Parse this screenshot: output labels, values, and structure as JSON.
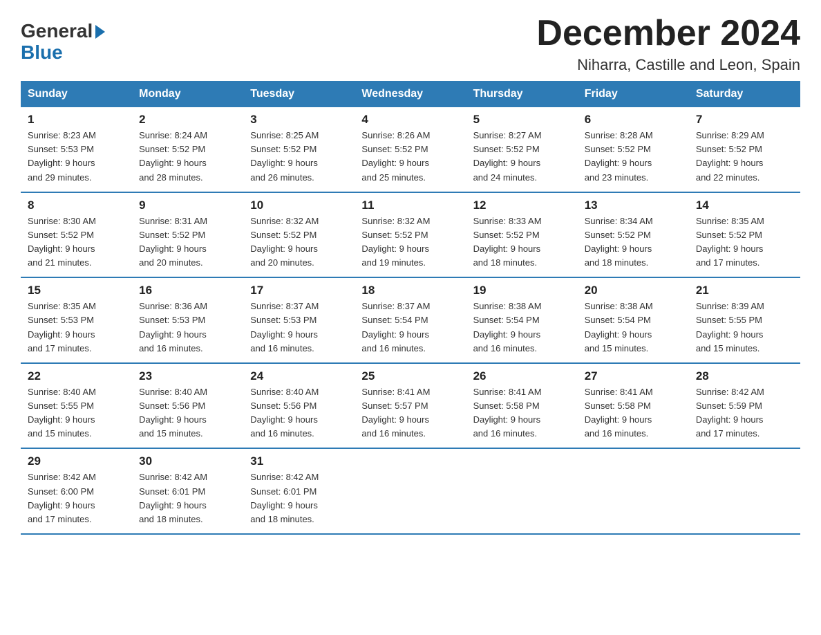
{
  "logo": {
    "general": "General",
    "blue": "Blue",
    "arrow": "▶"
  },
  "title": "December 2024",
  "subtitle": "Niharra, Castille and Leon, Spain",
  "weekdays": [
    "Sunday",
    "Monday",
    "Tuesday",
    "Wednesday",
    "Thursday",
    "Friday",
    "Saturday"
  ],
  "weeks": [
    [
      {
        "day": "1",
        "sunrise": "8:23 AM",
        "sunset": "5:53 PM",
        "daylight": "9 hours and 29 minutes."
      },
      {
        "day": "2",
        "sunrise": "8:24 AM",
        "sunset": "5:52 PM",
        "daylight": "9 hours and 28 minutes."
      },
      {
        "day": "3",
        "sunrise": "8:25 AM",
        "sunset": "5:52 PM",
        "daylight": "9 hours and 26 minutes."
      },
      {
        "day": "4",
        "sunrise": "8:26 AM",
        "sunset": "5:52 PM",
        "daylight": "9 hours and 25 minutes."
      },
      {
        "day": "5",
        "sunrise": "8:27 AM",
        "sunset": "5:52 PM",
        "daylight": "9 hours and 24 minutes."
      },
      {
        "day": "6",
        "sunrise": "8:28 AM",
        "sunset": "5:52 PM",
        "daylight": "9 hours and 23 minutes."
      },
      {
        "day": "7",
        "sunrise": "8:29 AM",
        "sunset": "5:52 PM",
        "daylight": "9 hours and 22 minutes."
      }
    ],
    [
      {
        "day": "8",
        "sunrise": "8:30 AM",
        "sunset": "5:52 PM",
        "daylight": "9 hours and 21 minutes."
      },
      {
        "day": "9",
        "sunrise": "8:31 AM",
        "sunset": "5:52 PM",
        "daylight": "9 hours and 20 minutes."
      },
      {
        "day": "10",
        "sunrise": "8:32 AM",
        "sunset": "5:52 PM",
        "daylight": "9 hours and 20 minutes."
      },
      {
        "day": "11",
        "sunrise": "8:32 AM",
        "sunset": "5:52 PM",
        "daylight": "9 hours and 19 minutes."
      },
      {
        "day": "12",
        "sunrise": "8:33 AM",
        "sunset": "5:52 PM",
        "daylight": "9 hours and 18 minutes."
      },
      {
        "day": "13",
        "sunrise": "8:34 AM",
        "sunset": "5:52 PM",
        "daylight": "9 hours and 18 minutes."
      },
      {
        "day": "14",
        "sunrise": "8:35 AM",
        "sunset": "5:52 PM",
        "daylight": "9 hours and 17 minutes."
      }
    ],
    [
      {
        "day": "15",
        "sunrise": "8:35 AM",
        "sunset": "5:53 PM",
        "daylight": "9 hours and 17 minutes."
      },
      {
        "day": "16",
        "sunrise": "8:36 AM",
        "sunset": "5:53 PM",
        "daylight": "9 hours and 16 minutes."
      },
      {
        "day": "17",
        "sunrise": "8:37 AM",
        "sunset": "5:53 PM",
        "daylight": "9 hours and 16 minutes."
      },
      {
        "day": "18",
        "sunrise": "8:37 AM",
        "sunset": "5:54 PM",
        "daylight": "9 hours and 16 minutes."
      },
      {
        "day": "19",
        "sunrise": "8:38 AM",
        "sunset": "5:54 PM",
        "daylight": "9 hours and 16 minutes."
      },
      {
        "day": "20",
        "sunrise": "8:38 AM",
        "sunset": "5:54 PM",
        "daylight": "9 hours and 15 minutes."
      },
      {
        "day": "21",
        "sunrise": "8:39 AM",
        "sunset": "5:55 PM",
        "daylight": "9 hours and 15 minutes."
      }
    ],
    [
      {
        "day": "22",
        "sunrise": "8:40 AM",
        "sunset": "5:55 PM",
        "daylight": "9 hours and 15 minutes."
      },
      {
        "day": "23",
        "sunrise": "8:40 AM",
        "sunset": "5:56 PM",
        "daylight": "9 hours and 15 minutes."
      },
      {
        "day": "24",
        "sunrise": "8:40 AM",
        "sunset": "5:56 PM",
        "daylight": "9 hours and 16 minutes."
      },
      {
        "day": "25",
        "sunrise": "8:41 AM",
        "sunset": "5:57 PM",
        "daylight": "9 hours and 16 minutes."
      },
      {
        "day": "26",
        "sunrise": "8:41 AM",
        "sunset": "5:58 PM",
        "daylight": "9 hours and 16 minutes."
      },
      {
        "day": "27",
        "sunrise": "8:41 AM",
        "sunset": "5:58 PM",
        "daylight": "9 hours and 16 minutes."
      },
      {
        "day": "28",
        "sunrise": "8:42 AM",
        "sunset": "5:59 PM",
        "daylight": "9 hours and 17 minutes."
      }
    ],
    [
      {
        "day": "29",
        "sunrise": "8:42 AM",
        "sunset": "6:00 PM",
        "daylight": "9 hours and 17 minutes."
      },
      {
        "day": "30",
        "sunrise": "8:42 AM",
        "sunset": "6:01 PM",
        "daylight": "9 hours and 18 minutes."
      },
      {
        "day": "31",
        "sunrise": "8:42 AM",
        "sunset": "6:01 PM",
        "daylight": "9 hours and 18 minutes."
      },
      null,
      null,
      null,
      null
    ]
  ],
  "labels": {
    "sunrise": "Sunrise:",
    "sunset": "Sunset:",
    "daylight": "Daylight:"
  }
}
